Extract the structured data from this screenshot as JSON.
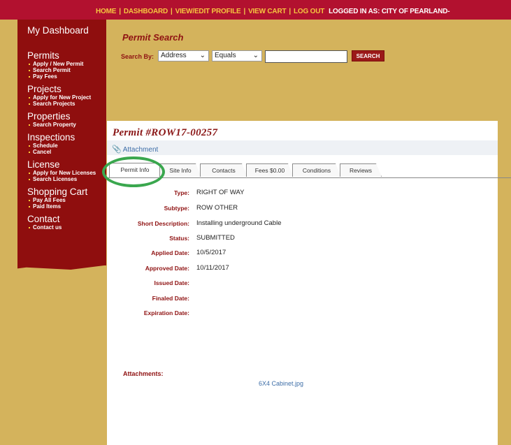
{
  "topnav": {
    "home": "HOME",
    "dashboard": "DASHBOARD",
    "profile": "VIEW/EDIT PROFILE",
    "cart": "VIEW CART",
    "logout": "LOG OUT",
    "logged_in_as": "LOGGED IN AS:  CITY OF PEARLAND-"
  },
  "sidebar": {
    "dashboard": "My Dashboard",
    "permits": {
      "title": "Permits",
      "links": [
        "Apply / New Permit",
        "Search Permit",
        "Pay Fees"
      ]
    },
    "projects": {
      "title": "Projects",
      "links": [
        "Apply for New Project",
        "Search Projects"
      ]
    },
    "properties": {
      "title": "Properties",
      "links": [
        "Search Property"
      ]
    },
    "inspections": {
      "title": "Inspections",
      "links": [
        "Schedule",
        "Cancel"
      ]
    },
    "license": {
      "title": "License",
      "links": [
        "Apply for New Licenses",
        "Search Licenses"
      ]
    },
    "cart": {
      "title": "Shopping Cart",
      "links": [
        "Pay All Fees",
        "Paid Items"
      ]
    },
    "contact": {
      "title": "Contact",
      "links": [
        "Contact us"
      ]
    }
  },
  "search": {
    "title": "Permit Search",
    "by_label": "Search By:",
    "field": "Address",
    "operator": "Equals",
    "value": "",
    "button": "SEARCH"
  },
  "permit": {
    "title": "Permit #ROW17-00257",
    "attachment_link": "Attachment"
  },
  "tabs": [
    "Permit Info",
    "Site Info",
    "Contacts",
    "Fees $0.00",
    "Conditions",
    "Reviews"
  ],
  "details": {
    "type_label": "Type:",
    "type": "RIGHT OF WAY",
    "subtype_label": "Subtype:",
    "subtype": "ROW OTHER",
    "desc_label": "Short Description:",
    "desc": "Installing underground Cable",
    "status_label": "Status:",
    "status": "SUBMITTED",
    "applied_label": "Applied Date:",
    "applied": "10/5/2017",
    "approved_label": "Approved Date:",
    "approved": "10/11/2017",
    "issued_label": "Issued Date:",
    "issued": "",
    "finaled_label": "Finaled Date:",
    "finaled": "",
    "expiration_label": "Expiration Date:",
    "expiration": ""
  },
  "attachments": {
    "heading": "Attachments:",
    "file": "6X4 Cabinet.jpg"
  },
  "colors": {
    "brand_red": "#b2112f",
    "sidebar_red": "#8f0e0e",
    "gold": "#d4b35c",
    "highlight_circle": "#3aa74e"
  }
}
